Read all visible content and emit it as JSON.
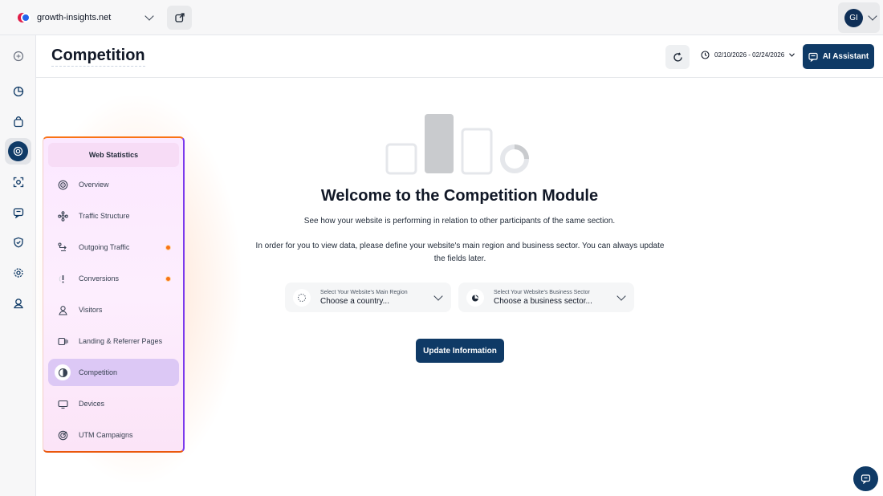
{
  "topbar": {
    "site_name": "growth-insights.net",
    "user_initials": "GI"
  },
  "header": {
    "page_title": "Competition",
    "date_range": "02/10/2026 - 02/24/2026",
    "ai_label": "AI Assistant"
  },
  "rail": {
    "items": [
      "compass-icon",
      "pie-chart-icon",
      "shopping-bag-icon",
      "web-statistics-icon",
      "scan-icon",
      "message-icon",
      "shield-check-icon",
      "settings-icon",
      "user-pin-icon"
    ]
  },
  "menu": {
    "title": "Web Statistics",
    "items": [
      {
        "label": "Overview",
        "icon": "target-icon"
      },
      {
        "label": "Traffic Structure",
        "icon": "network-icon"
      },
      {
        "label": "Outgoing Traffic",
        "icon": "route-icon",
        "badge": true
      },
      {
        "label": "Conversions",
        "icon": "alert-icon",
        "badge": true
      },
      {
        "label": "Visitors",
        "icon": "person-icon"
      },
      {
        "label": "Landing & Referrer Pages",
        "icon": "pages-icon"
      },
      {
        "label": "Competition",
        "icon": "half-circle-icon",
        "active": true
      },
      {
        "label": "Devices",
        "icon": "monitor-icon"
      },
      {
        "label": "UTM Campaigns",
        "icon": "radar-icon"
      }
    ]
  },
  "main": {
    "title": "Welcome to the Competition Module",
    "subtitle": "See how your website is performing in relation to other participants of the same section.",
    "description": "In order for you to view data, please define your website's main region and business sector. You can always update the fields later.",
    "region": {
      "label": "Select Your Website's Main Region",
      "value": "Choose a country..."
    },
    "sector": {
      "label": "Select Your Website's Business Sector",
      "value": "Choose a business sector..."
    },
    "update_label": "Update Information"
  },
  "colors": {
    "primary": "#0f3a66",
    "badge": "#f97316",
    "active_menu": "#dcc8f5"
  }
}
